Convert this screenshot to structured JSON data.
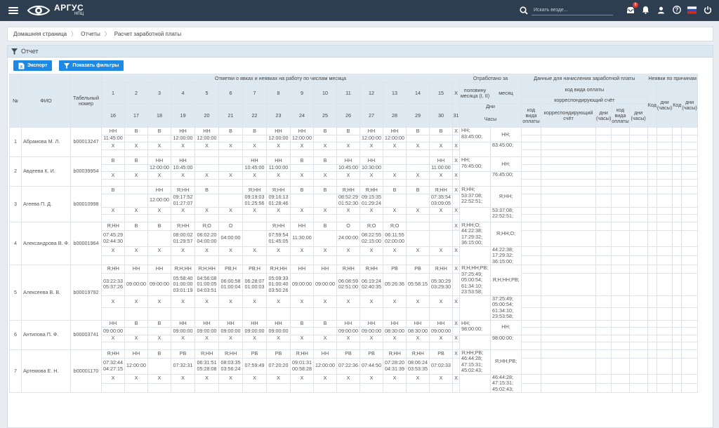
{
  "app": {
    "name": "АРГУС",
    "sub": "НПЦ"
  },
  "search": {
    "placeholder": "Искать везде..."
  },
  "notifications": {
    "count": "9"
  },
  "breadcrumb": [
    "Домашняя страница",
    "Отчеты",
    "Расчет заработной платы"
  ],
  "panel": {
    "title": "Отчет"
  },
  "buttons": {
    "export": "Экспорт",
    "filters": "Показать фильтры"
  },
  "table": {
    "h_num": "№",
    "h_fio": "ФИО",
    "h_tab": "Табельный номер",
    "h_marks": "Отметки о явках и неявках на работу по числам месяца",
    "h_worked": "Отработано за",
    "h_half": "половину месяца (I, II)",
    "h_month": "месяц",
    "h_days": "Дни",
    "h_hours": "Часы",
    "h_pay": "Данные для начисления заработной платы",
    "h_paycode": "код вида оплаты",
    "h_corr": "корреспондирующий счёт",
    "h_cod": "код вида оплаты",
    "h_corr2": "корреспондирующий счёт",
    "h_dh": "дни (часы)",
    "h_abs": "Неявки по причинам",
    "h_kod": "Код",
    "days1": [
      "1",
      "2",
      "3",
      "4",
      "5",
      "6",
      "7",
      "8",
      "9",
      "10",
      "11",
      "12",
      "13",
      "14",
      "15",
      "X"
    ],
    "days2": [
      "16",
      "17",
      "18",
      "19",
      "20",
      "21",
      "22",
      "23",
      "24",
      "25",
      "26",
      "27",
      "28",
      "29",
      "30",
      "31"
    ],
    "employees": [
      {
        "num": "1",
        "fio": "Абрамова М. Л.",
        "tab": "b00013247",
        "blocks": [
          [
            [
              "НН",
              "В",
              "В",
              "НН",
              "НН",
              "В",
              "В",
              "НН",
              "НН",
              "В",
              "В",
              "НН",
              "НН",
              "В",
              "В",
              "Х"
            ],
            [
              "11:45:00",
              "",
              "",
              "12:00:00",
              "12:00:00",
              "",
              "",
              "12:00:00",
              "12:00:00",
              "",
              "",
              "12:00:00",
              "12:00:00",
              "",
              "",
              ""
            ]
          ],
          [
            [
              "Х",
              "Х",
              "Х",
              "Х",
              "Х",
              "Х",
              "Х",
              "Х",
              "Х",
              "Х",
              "Х",
              "Х",
              "Х",
              "Х",
              "Х",
              "Х"
            ],
            [
              "",
              "",
              "",
              "",
              "",
              "",
              "",
              "",
              "",
              "",
              "",
              "",
              "",
              "",
              "",
              ""
            ]
          ]
        ],
        "half": [
          "НН;\n83:45:00;",
          ""
        ],
        "month": [
          "НН;",
          "83:45:00;"
        ]
      },
      {
        "num": "2",
        "fio": "Авдеева К. И.",
        "tab": "b00039954",
        "blocks": [
          [
            [
              "В",
              "В",
              "НН",
              "НН",
              "",
              "",
              "НН",
              "НН",
              "В",
              "В",
              "НН",
              "НН",
              "",
              "",
              "НН",
              "Х"
            ],
            [
              "",
              "",
              "12:00:00",
              "10:45:00",
              "",
              "",
              "10:45:00",
              "11:00:00",
              "",
              "",
              "10:45:00",
              "10:30:00",
              "",
              "",
              "11:00:00",
              ""
            ]
          ],
          [
            [
              "Х",
              "Х",
              "Х",
              "Х",
              "Х",
              "Х",
              "Х",
              "Х",
              "Х",
              "Х",
              "Х",
              "Х",
              "Х",
              "Х",
              "Х",
              "Х"
            ],
            [
              "",
              "",
              "",
              "",
              "",
              "",
              "",
              "",
              "",
              "",
              "",
              "",
              "",
              "",
              "",
              ""
            ]
          ]
        ],
        "half": [
          "НН;\n76:45:00;",
          ""
        ],
        "month": [
          "НН;",
          "76:45:00;"
        ]
      },
      {
        "num": "3",
        "fio": "Агеева П. Д.",
        "tab": "b00010998",
        "blocks": [
          [
            [
              "В",
              "",
              "НН",
              "Я;НН",
              "В",
              "",
              "Я;НН",
              "Я;НН",
              "В",
              "В",
              "Я;НН",
              "Я;НН",
              "В",
              "В",
              "Я;НН",
              "Х"
            ],
            [
              "",
              "",
              "12:00:00",
              "09:17:52\n01:27:07",
              "",
              "",
              "09:19:03\n01:25:56",
              "09:16:13\n01:28:46",
              "",
              "",
              "08:52:29\n01:52:30",
              "09:15:35\n01:29:24",
              "",
              "",
              "07:35:54\n03:09:05",
              ""
            ]
          ],
          [
            [
              "Х",
              "Х",
              "Х",
              "Х",
              "Х",
              "Х",
              "Х",
              "Х",
              "Х",
              "Х",
              "Х",
              "Х",
              "Х",
              "Х",
              "Х",
              "Х"
            ],
            [
              "",
              "",
              "",
              "",
              "",
              "",
              "",
              "",
              "",
              "",
              "",
              "",
              "",
              "",
              "",
              ""
            ]
          ]
        ],
        "half": [
          "Я;НН;\n53:37:08;\n22:52:51;",
          ""
        ],
        "month": [
          "Я;НН;",
          "53:37:08;\n22:52:51;"
        ]
      },
      {
        "num": "4",
        "fio": "Александрова В. Ф.",
        "tab": "b00001964",
        "blocks": [
          [
            [
              "Я;НН",
              "В",
              "В",
              "Я;НН",
              "Я;О",
              "О",
              "",
              "Я;НН",
              "НН",
              "В",
              "О",
              "Я;О",
              "Я;О",
              "",
              "",
              "Х"
            ],
            [
              "07:45:29\n02:44:30",
              "",
              "",
              "08:00:02\n01:29:57",
              "06:02:20\n04:00:00",
              "04:00:00",
              "",
              "07:59:54\n01:45:05",
              "11:30:00",
              "",
              "24:00:00",
              "08:22:55\n02:15:00",
              "06:11:55\n02:00:00",
              "",
              "",
              ""
            ]
          ],
          [
            [
              "Х",
              "Х",
              "Х",
              "Х",
              "Х",
              "Х",
              "Х",
              "Х",
              "Х",
              "Х",
              "Х",
              "Х",
              "Х",
              "Х",
              "Х",
              "Х"
            ],
            [
              "",
              "",
              "",
              "",
              "",
              "",
              "",
              "",
              "",
              "",
              "",
              "",
              "",
              "",
              "",
              ""
            ]
          ]
        ],
        "half": [
          "Я;НН;О;\n44:22:38;\n17:29:32;\n36:15:00;",
          ""
        ],
        "month": [
          "Я;НН;О;",
          "44:22:38;\n17:29:32;\n36:15:00;"
        ]
      },
      {
        "num": "5",
        "fio": "Алексеева В. В.",
        "tab": "b00019792",
        "blocks": [
          [
            [
              "Я;НН",
              "НН",
              "НН",
              "Я;Н;НН",
              "Я;Н;НН",
              "РВ;Н",
              "РВ;Н",
              "Я;Н;НН",
              "НН",
              "НН",
              "Я;НН",
              "Я;НН",
              "РВ",
              "РВ",
              "Я;НН",
              "Х"
            ],
            [
              "03:22:33\n05:37:26",
              "09:00:00",
              "09:00:00",
              "05:58:40\n01:00:00\n03:01:19",
              "04:56:08\n01:00:05\n04:03:51",
              "06:00:58\n01:00:04",
              "06:28:07\n01:00:03",
              "05:09:33\n01:00:40\n03:50:26",
              "09:00:00",
              "09:00:00",
              "06:08:59\n02:51:00",
              "06:19:24\n02:40:35",
              "05:26:36",
              "05:58:15",
              "05:30:29\n03:29:30",
              ""
            ]
          ],
          [
            [
              "Х",
              "Х",
              "Х",
              "Х",
              "Х",
              "Х",
              "Х",
              "Х",
              "Х",
              "Х",
              "Х",
              "Х",
              "Х",
              "Х",
              "Х",
              "Х"
            ],
            [
              "",
              "",
              "",
              "",
              "",
              "",
              "",
              "",
              "",
              "",
              "",
              "",
              "",
              "",
              "",
              ""
            ]
          ]
        ],
        "half": [
          "Я;Н;НН;РВ;\n37:25:49;\n05:00:54;\n61:34:10;\n23:53:58;",
          ""
        ],
        "month": [
          "Я;Н;НН;РВ;",
          "37:25:49;\n05:00:54;\n61:34:10;\n23:53:58;"
        ]
      },
      {
        "num": "6",
        "fio": "Антипова П. Ф.",
        "tab": "b00003741",
        "blocks": [
          [
            [
              "НН",
              "В",
              "В",
              "НН",
              "НН",
              "НН",
              "НН",
              "НН",
              "В",
              "В",
              "НН",
              "НН",
              "НН",
              "НН",
              "НН",
              "Х"
            ],
            [
              "09:00:00",
              "",
              "",
              "09:00:00",
              "09:00:00",
              "09:00:00",
              "09:00:00",
              "09:00:00",
              "",
              "",
              "09:00:00",
              "09:00:00",
              "08:30:00",
              "08:30:00",
              "09:00:00",
              ""
            ]
          ],
          [
            [
              "Х",
              "Х",
              "Х",
              "Х",
              "Х",
              "Х",
              "Х",
              "Х",
              "Х",
              "Х",
              "Х",
              "Х",
              "Х",
              "Х",
              "Х",
              "Х"
            ],
            [
              "",
              "",
              "",
              "",
              "",
              "",
              "",
              "",
              "",
              "",
              "",
              "",
              "",
              "",
              "",
              ""
            ]
          ]
        ],
        "half": [
          "НН;\n98:00:00;",
          ""
        ],
        "month": [
          "НН;",
          "98:00:00;"
        ]
      },
      {
        "num": "7",
        "fio": "Артемова Е. Н.",
        "tab": "b00001170",
        "blocks": [
          [
            [
              "Я;НН",
              "НН",
              "В",
              "РВ",
              "Я;НН",
              "Я;НН",
              "РВ",
              "РВ",
              "Я;НН",
              "НН",
              "РВ",
              "РВ",
              "Я;НН",
              "Я;НН",
              "РВ",
              "Х"
            ],
            [
              "07:32:44\n04:27:15",
              "12:00:00",
              "",
              "07:32:31",
              "06:31:51\n05:28:08",
              "08:03:35\n03:56:24",
              "07:59:49",
              "07:20:20",
              "09:01:31\n00:58:28",
              "12:00:00",
              "07:22:36",
              "07:44:50",
              "07:28:20\n04:31:39",
              "08:06:24\n03:53:35",
              "07:02:33",
              ""
            ]
          ],
          [
            [
              "Х",
              "Х",
              "Х",
              "Х",
              "Х",
              "Х",
              "Х",
              "Х",
              "Х",
              "Х",
              "Х",
              "Х",
              "Х",
              "Х",
              "Х",
              "Х"
            ],
            [
              "",
              "",
              "",
              "",
              "",
              "",
              "",
              "",
              "",
              "",
              "",
              "",
              "",
              "",
              "",
              ""
            ]
          ]
        ],
        "half": [
          "Я;НН;РВ;\n46:44:28;\n47:15:31;\n45:02:43;",
          ""
        ],
        "month": [
          "Я;НН;РВ;",
          "46:44:28;\n47:15:31;\n45:02:43;"
        ]
      }
    ]
  }
}
